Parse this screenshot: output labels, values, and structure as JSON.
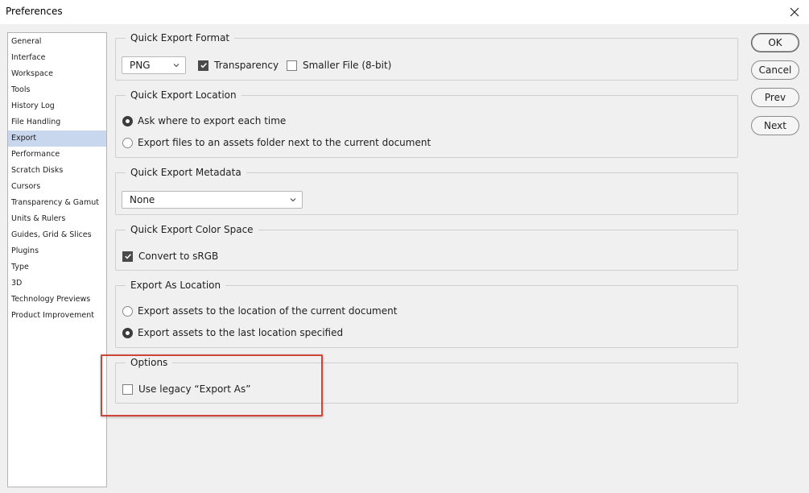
{
  "window": {
    "title": "Preferences",
    "close_icon": "close-icon"
  },
  "sidebar": {
    "items": [
      {
        "label": "General"
      },
      {
        "label": "Interface"
      },
      {
        "label": "Workspace"
      },
      {
        "label": "Tools"
      },
      {
        "label": "History Log"
      },
      {
        "label": "File Handling"
      },
      {
        "label": "Export",
        "selected": true
      },
      {
        "label": "Performance"
      },
      {
        "label": "Scratch Disks"
      },
      {
        "label": "Cursors"
      },
      {
        "label": "Transparency & Gamut"
      },
      {
        "label": "Units & Rulers"
      },
      {
        "label": "Guides, Grid & Slices"
      },
      {
        "label": "Plugins"
      },
      {
        "label": "Type"
      },
      {
        "label": "3D"
      },
      {
        "label": "Technology Previews"
      },
      {
        "label": "Product Improvement"
      }
    ]
  },
  "quick_export_format": {
    "title": "Quick Export Format",
    "format_value": "PNG",
    "transparency_label": "Transparency",
    "transparency_checked": true,
    "smaller_file_label": "Smaller File (8-bit)",
    "smaller_file_checked": false
  },
  "quick_export_location": {
    "title": "Quick Export Location",
    "option_ask_label": "Ask where to export each time",
    "option_ask_selected": true,
    "option_assets_label": "Export files to an assets folder next to the current document",
    "option_assets_selected": false
  },
  "quick_export_metadata": {
    "title": "Quick Export Metadata",
    "value": "None"
  },
  "quick_export_color_space": {
    "title": "Quick Export Color Space",
    "convert_label": "Convert to sRGB",
    "convert_checked": true
  },
  "export_as_location": {
    "title": "Export As Location",
    "option_current_label": "Export assets to the location of the current document",
    "option_current_selected": false,
    "option_last_label": "Export assets to the last location specified",
    "option_last_selected": true
  },
  "options": {
    "title": "Options",
    "legacy_label": "Use legacy “Export As”",
    "legacy_checked": false
  },
  "buttons": {
    "ok": "OK",
    "cancel": "Cancel",
    "prev": "Prev",
    "next": "Next"
  },
  "colors": {
    "selection": "#c8d6ee",
    "highlight_box": "#d0443a"
  }
}
